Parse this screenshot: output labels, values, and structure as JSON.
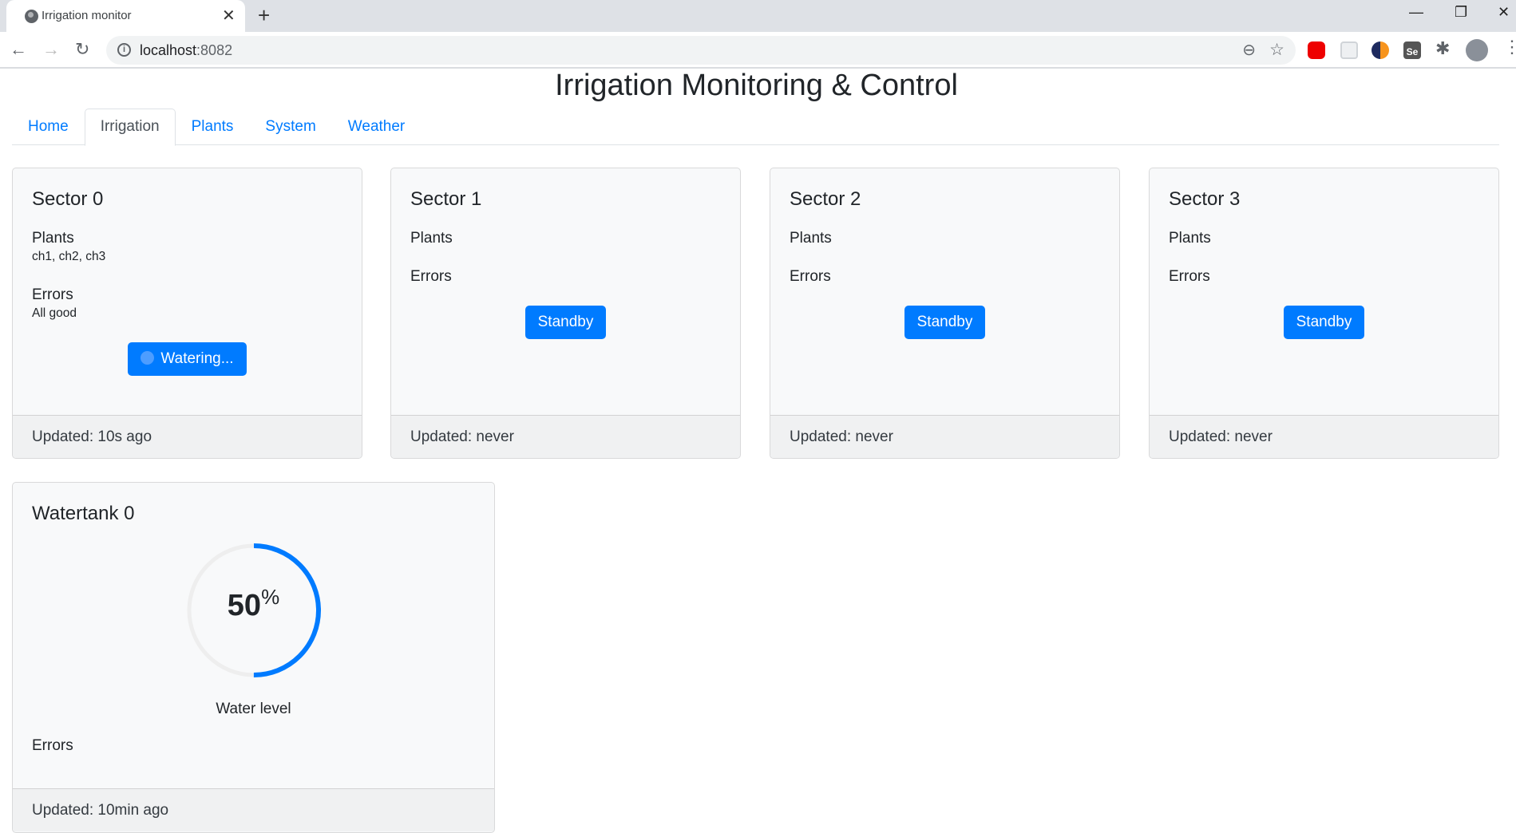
{
  "browser": {
    "tab_title": "Irrigation monitor",
    "url_host": "localhost",
    "url_port": ":8082"
  },
  "page": {
    "title": "Irrigation Monitoring & Control",
    "nav": [
      {
        "label": "Home",
        "active": false
      },
      {
        "label": "Irrigation",
        "active": true
      },
      {
        "label": "Plants",
        "active": false
      },
      {
        "label": "System",
        "active": false
      },
      {
        "label": "Weather",
        "active": false
      }
    ]
  },
  "sectors": [
    {
      "title": "Sector 0",
      "plants_label": "Plants",
      "plants": "ch1, ch2, ch3",
      "errors_label": "Errors",
      "errors": "All good",
      "button": "Watering...",
      "updated": "Updated: 10s ago"
    },
    {
      "title": "Sector 1",
      "plants_label": "Plants",
      "errors_label": "Errors",
      "button": "Standby",
      "updated": "Updated: never"
    },
    {
      "title": "Sector 2",
      "plants_label": "Plants",
      "errors_label": "Errors",
      "button": "Standby",
      "updated": "Updated: never"
    },
    {
      "title": "Sector 3",
      "plants_label": "Plants",
      "errors_label": "Errors",
      "button": "Standby",
      "updated": "Updated: never"
    }
  ],
  "watertank": {
    "title": "Watertank 0",
    "level_percent": 50,
    "level_value": "50",
    "level_unit": "%",
    "level_label": "Water level",
    "errors_label": "Errors",
    "updated": "Updated: 10min ago"
  },
  "colors": {
    "primary": "#007bff",
    "card_bg": "#f8f9fa",
    "gauge_track": "#eeeeee"
  }
}
